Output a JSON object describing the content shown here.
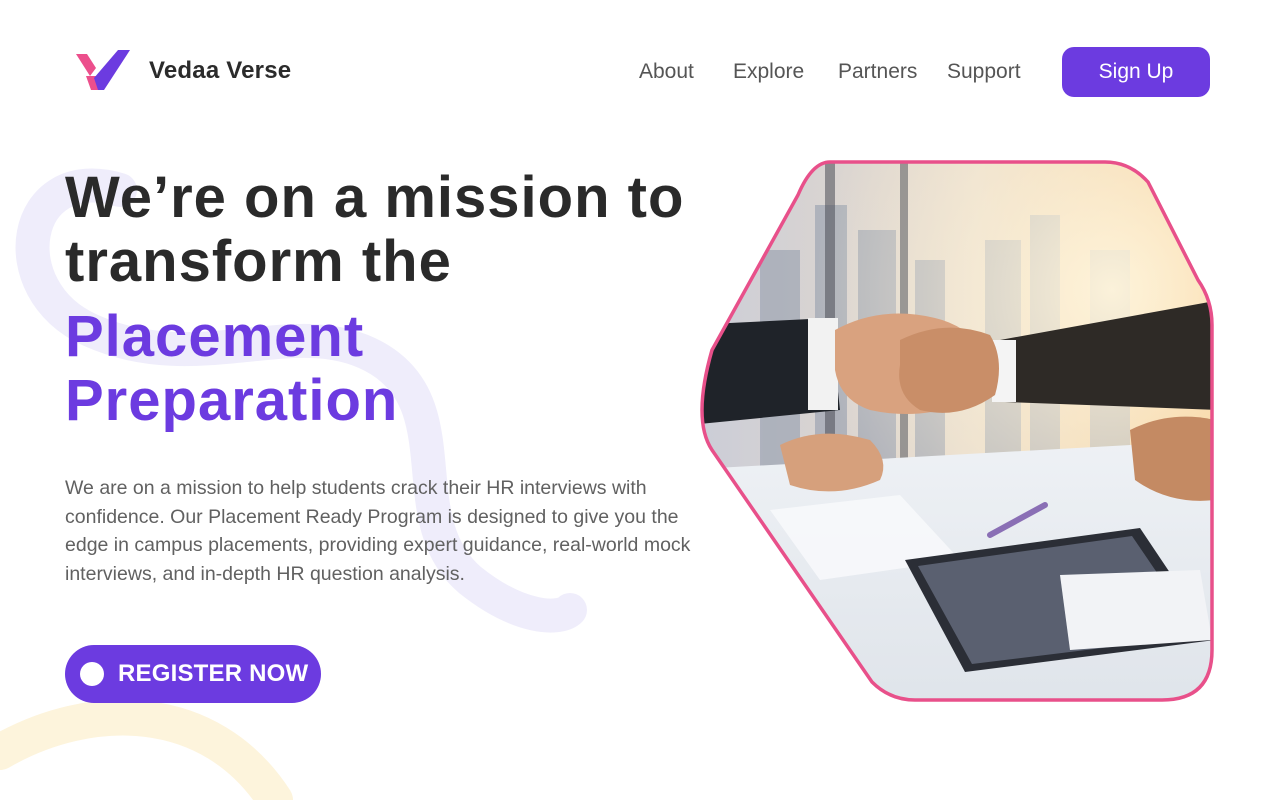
{
  "brand": {
    "name": "Vedaa Verse",
    "logo_icon": "vv-chevron-logo"
  },
  "nav": {
    "items": [
      {
        "label": "About"
      },
      {
        "label": "Explore"
      },
      {
        "label": "Partners"
      },
      {
        "label": "Support"
      }
    ],
    "signup_label": "Sign Up"
  },
  "hero": {
    "headline_line1": "We’re on a mission to",
    "headline_line2": "transform the",
    "accent_line1": "Placement",
    "accent_line2": "Preparation",
    "description": "We are on a mission to help students crack their HR interviews with confidence. Our Placement Ready Program is designed to give you the edge in campus placements, providing expert guidance, real-world mock interviews, and in-depth HR question analysis.",
    "cta_label": "REGISTER NOW",
    "image_subject": "handshake-photo"
  },
  "colors": {
    "accent": "#6c3be0",
    "frame_pink": "#e8508a",
    "logo_pink": "#ec4f8c",
    "heading": "#2a2a2a"
  }
}
